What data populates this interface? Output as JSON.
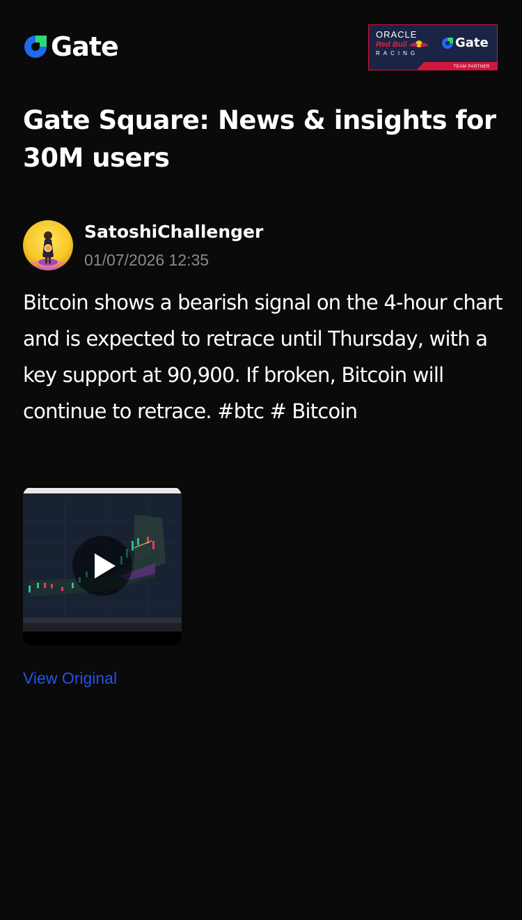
{
  "header": {
    "brand_name": "Gate",
    "brand_icon": "gate-logo-icon",
    "partner_badge": {
      "oracle": "ORACLE",
      "redbull": "Red Bull",
      "racing": "RACING",
      "gate": "Gate",
      "team_partner": "TEAM PARTNER"
    }
  },
  "page": {
    "title": "Gate Square: News & insights for 30M users"
  },
  "post": {
    "author": "SatoshiChallenger",
    "timestamp": "01/07/2026 12:35",
    "body": "Bitcoin shows a bearish signal on the 4-hour chart and is expected to retrace until Thursday, with a key support at 90,900. If broken, Bitcoin will continue to retrace. #btc # Bitcoin",
    "media": {
      "type": "video",
      "icon": "play-icon"
    },
    "view_original": "View Original"
  },
  "colors": {
    "background": "#0a0a0a",
    "text": "#ffffff",
    "muted": "#8a8a8a",
    "link": "#2354e6",
    "brand_blue": "#1f6bf0",
    "brand_green": "#2fd67a",
    "badge_bg": "#1b2444",
    "badge_red": "#d1173b"
  }
}
